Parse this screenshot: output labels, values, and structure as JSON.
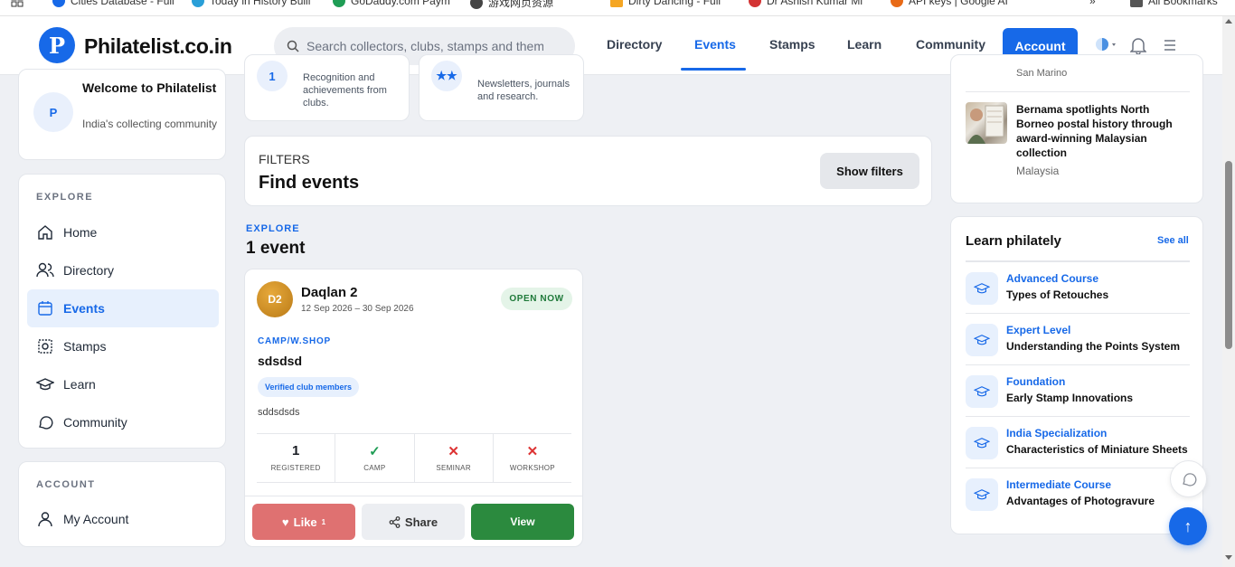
{
  "bookmarks": [
    {
      "label": "Cities Database - Full",
      "color": "#1769e8"
    },
    {
      "label": "Today in History Bulli",
      "color": "#2a9fd8"
    },
    {
      "label": "GoDaddy.com Paym",
      "color": "#1f9d55"
    },
    {
      "label": "游戏网页资源",
      "color": "#444444"
    },
    {
      "label": "Dirty Dancing - Full",
      "color": "#f5a623"
    },
    {
      "label": "Dr Ashish Kumar Mi",
      "color": "#d33333"
    },
    {
      "label": "API keys | Google AI",
      "color": "#e86a17"
    },
    {
      "label": "All Bookmarks",
      "color": "#555555"
    }
  ],
  "header": {
    "logo_letter": "P",
    "brand": "Philatelist.co.in",
    "search_placeholder": "Search collectors, clubs, stamps and themes",
    "nav": [
      "Directory",
      "Events",
      "Stamps",
      "Learn",
      "Community"
    ],
    "active_nav": "Events",
    "account_label": "Account"
  },
  "welcome": {
    "avatar": "P",
    "title": "Welcome to Philatelist",
    "subtitle": "India's collecting community"
  },
  "explore": {
    "label": "EXPLORE",
    "items": [
      {
        "label": "Home",
        "icon": "home-icon"
      },
      {
        "label": "Directory",
        "icon": "users-icon"
      },
      {
        "label": "Events",
        "icon": "calendar-icon",
        "active": true
      },
      {
        "label": "Stamps",
        "icon": "stamp-icon"
      },
      {
        "label": "Learn",
        "icon": "graduation-cap-icon"
      },
      {
        "label": "Community",
        "icon": "chat-icon"
      }
    ]
  },
  "account_section": {
    "label": "ACCOUNT",
    "item": "My Account"
  },
  "mini_cards": [
    {
      "icon_glyph": "1",
      "text": "Recognition and achievements from clubs."
    },
    {
      "icon_glyph": "★★",
      "text": "Newsletters, journals and research."
    }
  ],
  "filters": {
    "label": "FILTERS",
    "title": "Find events",
    "button": "Show filters"
  },
  "results": {
    "label": "EXPLORE",
    "count": "1 event"
  },
  "event": {
    "initials": "D2",
    "title": "Daqlan 2",
    "dates": "12 Sep 2026 – 30 Sep 2026",
    "status": "OPEN NOW",
    "category": "CAMP/W.SHOP",
    "name": "sdsdsd",
    "tag": "Verified club members",
    "description": "sddsdsds",
    "stats": [
      {
        "value": "1",
        "label": "REGISTERED",
        "kind": "number"
      },
      {
        "value": "✓",
        "label": "CAMP",
        "kind": "ok"
      },
      {
        "value": "✕",
        "label": "SEMINAR",
        "kind": "no"
      },
      {
        "value": "✕",
        "label": "WORKSHOP",
        "kind": "no"
      }
    ],
    "like_label": "Like",
    "like_count": "1",
    "share_label": "Share",
    "view_label": "View"
  },
  "news": {
    "prev_country": "San Marino",
    "title": "Bernama spotlights North Borneo postal history through award-winning Malaysian collection",
    "country": "Malaysia"
  },
  "learn": {
    "title": "Learn philately",
    "see_all": "See all",
    "items": [
      {
        "level": "Advanced Course",
        "topic": "Types of Retouches"
      },
      {
        "level": "Expert Level",
        "topic": "Understanding the Points System"
      },
      {
        "level": "Foundation",
        "topic": "Early Stamp Innovations"
      },
      {
        "level": "India Specialization",
        "topic": "Characteristics of Miniature Sheets"
      },
      {
        "level": "Intermediate Course",
        "topic": "Advantages of Photogravure"
      }
    ]
  },
  "colors": {
    "accent": "#1769e8",
    "open": "#1f7a3a",
    "like": "#df7171",
    "view": "#2b8a3e"
  }
}
